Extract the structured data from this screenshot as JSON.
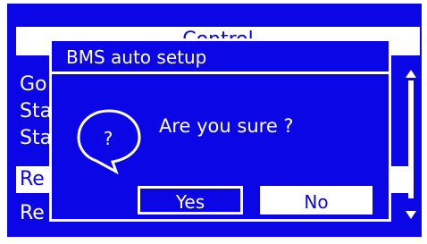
{
  "menu": {
    "title": "Control",
    "items": [
      {
        "label": "Go"
      },
      {
        "label": "Sta"
      },
      {
        "label": "Sta"
      },
      {
        "label": "Re"
      },
      {
        "label": "Re"
      }
    ]
  },
  "dialog": {
    "title": "BMS auto setup",
    "icon_symbol": "?",
    "icon": "question-speech-bubble-icon",
    "message": "Are you sure ?",
    "yes_label": "Yes",
    "no_label": "No"
  },
  "colors": {
    "screen_background": "#0b06e6",
    "foreground": "#ffffff"
  }
}
